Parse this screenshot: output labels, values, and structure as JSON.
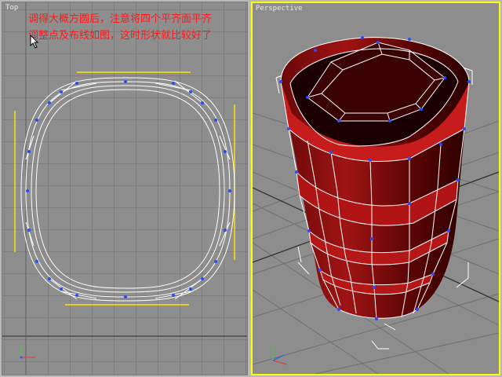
{
  "viewports": {
    "top": {
      "label": "Top"
    },
    "perspective": {
      "label": "Perspective"
    }
  },
  "annotation": {
    "line1": "调得大概方圆后，注意将四个平齐面平齐",
    "line2": "调整点及布线如图，这时形状就比较好了"
  },
  "colors": {
    "grid_bg": "#8e8e8e",
    "grid_line": "#6f6f6f",
    "wire": "#ffffff",
    "vertex": "#2a4cff",
    "guide": "#ffe000",
    "active_border": "#ffff00",
    "mesh_red": "#9c1010",
    "note_text": "#ff1a1a"
  }
}
